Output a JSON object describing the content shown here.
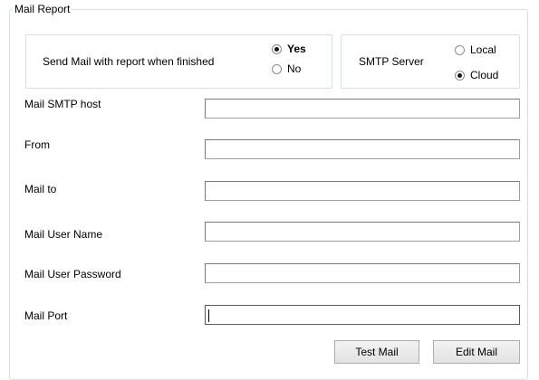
{
  "group": {
    "title": "Mail Report"
  },
  "send_mail": {
    "label": "Send Mail with report when finished",
    "options": [
      {
        "label": "Yes",
        "checked": true
      },
      {
        "label": "No",
        "checked": false
      }
    ]
  },
  "smtp_server": {
    "label": "SMTP Server",
    "options": [
      {
        "label": "Local",
        "checked": false
      },
      {
        "label": "Cloud",
        "checked": true
      }
    ]
  },
  "fields": [
    {
      "label": "Mail SMTP host",
      "value": ""
    },
    {
      "label": "From",
      "value": ""
    },
    {
      "label": "Mail to",
      "value": ""
    },
    {
      "label": "Mail User Name",
      "value": ""
    },
    {
      "label": "Mail User Password",
      "value": ""
    },
    {
      "label": "Mail Port",
      "value": ""
    }
  ],
  "buttons": {
    "test_mail": "Test Mail",
    "edit_mail": "Edit Mail"
  }
}
